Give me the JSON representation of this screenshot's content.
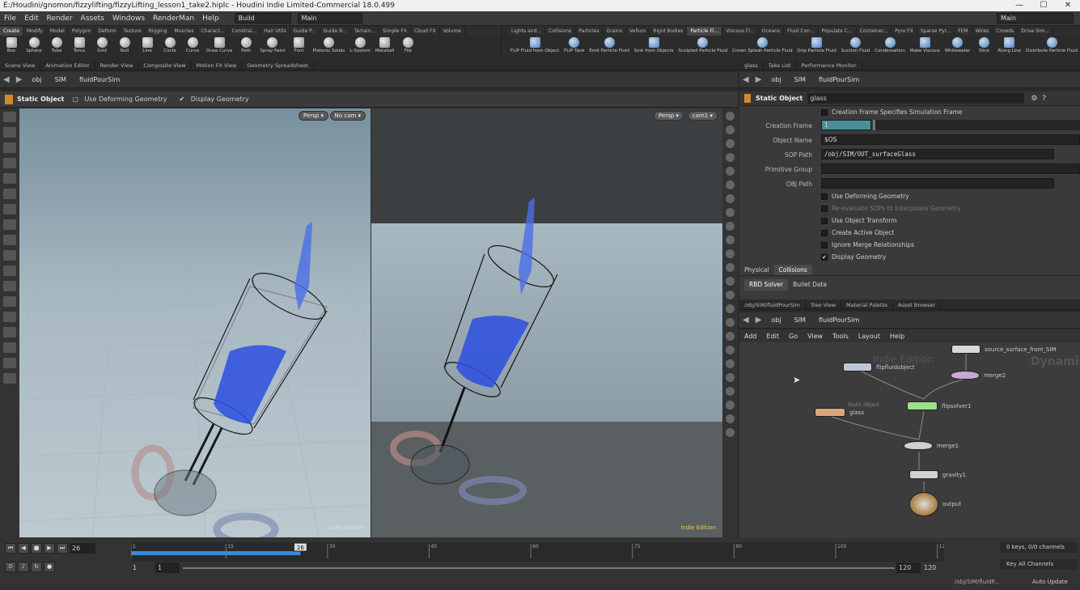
{
  "window": {
    "title": "E:/Houdini/gnomon/fizzylifting/fizzyLifting_lesson1_take2.hiplc - Houdini Indie Limited-Commercial 18.0.499",
    "min": "—",
    "max": "☐",
    "close": "✕"
  },
  "menu": [
    "File",
    "Edit",
    "Render",
    "Assets",
    "Windows",
    "RenderMan",
    "Help"
  ],
  "desktop_build": "Build",
  "desktop_main": "Main",
  "desktop_main_right": "Main",
  "shelf_left": {
    "tabs": [
      "Create",
      "Modify",
      "Model",
      "Polygon",
      "Deform",
      "Texture",
      "Rigging",
      "Muscles",
      "Charact...",
      "Constrai...",
      "Hair Utils",
      "Guide P...",
      "Guide B...",
      "Terrain...",
      "Simple FX",
      "Cloud FX",
      "Volume"
    ],
    "tools": [
      "Box",
      "Sphere",
      "Tube",
      "Torus",
      "Grid",
      "Null",
      "Line",
      "Circle",
      "Curve",
      "Draw Curve",
      "Path",
      "Spray Paint",
      "Font",
      "Platonic Solids",
      "L-System",
      "Metaball",
      "File"
    ]
  },
  "shelf_right": {
    "tabs": [
      "Lights and...",
      "Collisions",
      "Particles",
      "Grains",
      "Vellum",
      "Rigid Bodies",
      "Particle Fl...",
      "Viscous Fl...",
      "Oceans",
      "Fluid Con...",
      "Populate C...",
      "Container...",
      "Pyro FX",
      "Sparse Pyr...",
      "FEM",
      "Wires",
      "Crowds",
      "Drive Sim..."
    ],
    "tools": [
      "FLIP Fluid from Object",
      "FLIP Tank",
      "Emit Particle Fluid",
      "Sink from Objects",
      "Sculpted Particle Fluid",
      "Crown Splash Particle Fluid",
      "Drip Particle Fluid",
      "Suction Fluid",
      "Condensation",
      "Make Viscous",
      "Whitewater",
      "Slice",
      "Along Line",
      "Distribute Particle Fluid"
    ]
  },
  "left_pane_tabs": [
    "Scene View",
    "Animation Editor",
    "Render View",
    "Composite View",
    "Motion FX View",
    "Geometry Spreadsheet"
  ],
  "path": {
    "obj": "obj",
    "sim": "SIM",
    "node": "fluidPourSim"
  },
  "vp_toolbar": {
    "title": "Static Object",
    "use_deform": "Use Deforming Geometry",
    "display_geo": "Display Geometry"
  },
  "viewport_left": {
    "persp": "Persp ▾",
    "cam": "No cam ▾",
    "edition": "Indie Edition"
  },
  "viewport_right": {
    "persp": "Persp ▾",
    "cam": "cam1 ▾",
    "edition": "Indie Edition"
  },
  "right_pane_tabs": [
    "glass",
    "Take List",
    "Performance Monitor"
  ],
  "params": {
    "type": "Static Object",
    "name": "glass",
    "creation_frame_specifies": "Creation Frame Specifies Simulation Frame",
    "creation_frame_label": "Creation Frame",
    "creation_frame_value": "1",
    "object_name_label": "Object Name",
    "object_name_value": "$OS",
    "sop_path_label": "SOP Path",
    "sop_path_value": "/obj/SIM/OUT_surfaceGlass",
    "primitive_group_label": "Primitive Group",
    "obj_path_label": "OBJ Path",
    "checks": [
      "Use Deforming Geometry",
      "Re-evaluate SOPs to Interpolate Geometry",
      "Use Object Transform",
      "Create Active Object",
      "Ignore Merge Relationships",
      "Display Geometry"
    ],
    "tabs": [
      "Physical",
      "Collisions"
    ],
    "subtabs": [
      "RBD Solver",
      "Bullet Data"
    ]
  },
  "net_tabs": [
    "/obj/SIM/fluidPourSim",
    "Tree View",
    "Material Palette",
    "Asset Browser"
  ],
  "net_menu": [
    "Add",
    "Edit",
    "Go",
    "View",
    "Tools",
    "Layout",
    "Help"
  ],
  "net_watermark": "Indie Edition",
  "net_watermark2": "Dynamics",
  "nodes": {
    "source": "source_surface_from_SIM",
    "flipfluid": "flipfluidobject",
    "merge2": "merge2",
    "flipsolver": "flipsolver1",
    "glass_type": "Static Object",
    "glass": "glass",
    "merge1": "merge1",
    "gravity": "gravity1",
    "output": "output"
  },
  "timeline": {
    "current_frame": "26",
    "ticks": [
      "1",
      "15",
      "30",
      "45",
      "60",
      "75",
      "90",
      "105",
      "12"
    ],
    "marker": "26",
    "start": "1",
    "start2": "1",
    "end": "120",
    "end2": "120",
    "keys": "0 keys, 0/0 channels",
    "key_all": "Key All Channels",
    "auto_update": "Auto Update",
    "status_path": "/obj/SIM/fluidP..."
  }
}
